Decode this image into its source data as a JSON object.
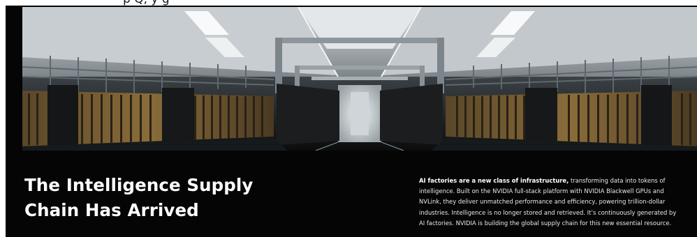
{
  "top_strip": {
    "text": "p                        Q,                                                                    y                   g"
  },
  "hero": {
    "image_label": "ai-factory-datacenter-image"
  },
  "headline": {
    "line1": "The Intelligence Supply",
    "line2": "Chain Has Arrived"
  },
  "body": {
    "lead": "AI factories are a new class of infrastructure,",
    "line1_rest": " transforming data into tokens of",
    "line2": "intelligence. Built on the NVIDIA full-stack platform with NVIDIA Blackwell GPUs and",
    "line3": "NVLink, they deliver unmatched performance and efficiency, powering trillion-dollar",
    "line4": "industries. Intelligence is no longer stored and retrieved. It’s continuously generated by",
    "line5": "AI factories. NVIDIA is building the global supply chain for this new essential resource."
  },
  "colors": {
    "background": "#050505",
    "headline": "#ffffff",
    "body_text": "#e9e9e9"
  }
}
